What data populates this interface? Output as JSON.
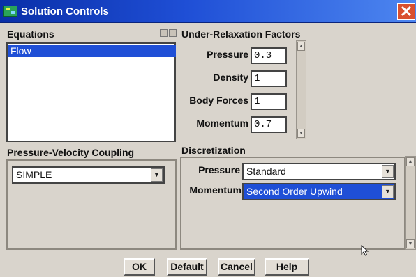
{
  "window": {
    "title": "Solution Controls"
  },
  "equations": {
    "label": "Equations",
    "items": [
      "Flow"
    ]
  },
  "under_relaxation": {
    "label": "Under-Relaxation Factors",
    "fields": [
      {
        "label": "Pressure",
        "value": "0.3"
      },
      {
        "label": "Density",
        "value": "1"
      },
      {
        "label": "Body Forces",
        "value": "1"
      },
      {
        "label": "Momentum",
        "value": "0.7"
      }
    ]
  },
  "coupling": {
    "label": "Pressure-Velocity Coupling",
    "value": "SIMPLE"
  },
  "discretization": {
    "label": "Discretization",
    "rows": [
      {
        "label": "Pressure",
        "value": "Standard"
      },
      {
        "label": "Momentum",
        "value": "Second Order Upwind"
      }
    ]
  },
  "buttons": {
    "ok": "OK",
    "default": "Default",
    "cancel": "Cancel",
    "help": "Help"
  },
  "colors": {
    "title_bar": "#1f4fd6",
    "selection": "#1f4fd6",
    "close": "#d9502f"
  }
}
